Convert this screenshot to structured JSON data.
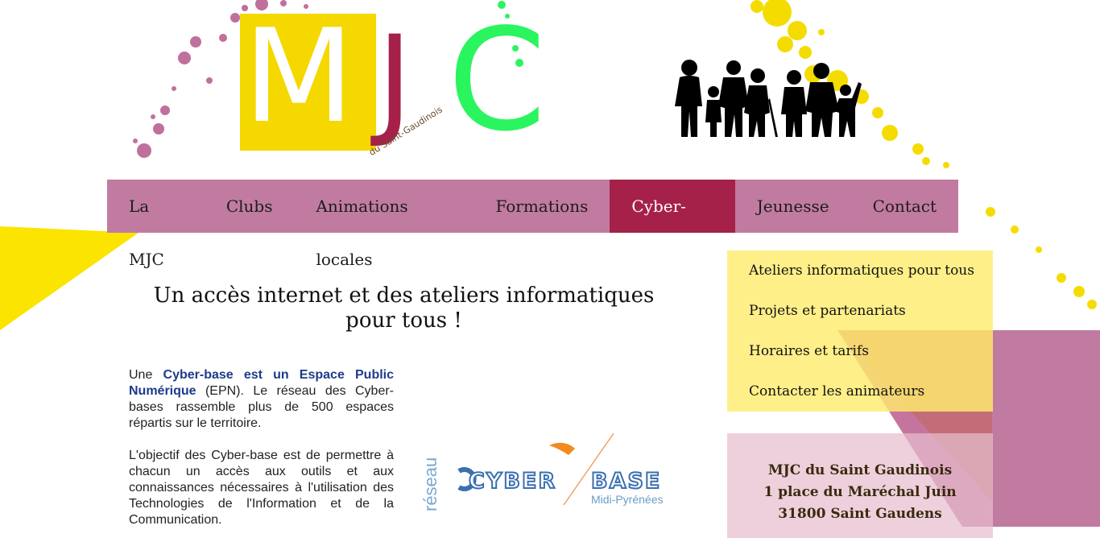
{
  "logo": {
    "letter_m": "M",
    "letter_j": "J",
    "letter_c": "C",
    "subtitle": "du Saint-Gaudinois"
  },
  "colors": {
    "nav_bg": "#c17ba0",
    "nav_active": "#a6214a",
    "yellow": "#f5d800",
    "green": "#2af55f",
    "link_blue": "#1d3b8a"
  },
  "nav": {
    "items": [
      {
        "label": "La MJC"
      },
      {
        "label": "Clubs"
      },
      {
        "label": "Animations locales"
      },
      {
        "label": "Formations"
      },
      {
        "label": "Cyber-base"
      },
      {
        "label": "Jeunesse"
      },
      {
        "label": "Contact"
      }
    ],
    "active": "Cyber-base"
  },
  "main": {
    "heading_line1": "Un accès internet et des ateliers informatiques",
    "heading_line2": "pour tous !",
    "p1_start": "Une ",
    "p1_bold": "Cyber-base est un Espace Public Numérique",
    "p1_rest": " (EPN). Le réseau des Cyber-bases rassemble plus de 500 espaces répartis sur le territoire.",
    "p2": "L'objectif des Cyber-base est de permettre à chacun un accès aux outils et aux connaissances nécessaires à l'utilisation des Technologies de l'Information et de la Communication."
  },
  "cyberbase_logo": {
    "vertical": "réseau",
    "word1": "CYBER",
    "word2": "BASE",
    "region": "Midi-Pyrénées"
  },
  "submenu": {
    "items": [
      {
        "label": "Ateliers informatiques pour tous"
      },
      {
        "label": "Projets et partenariats"
      },
      {
        "label": "Horaires et tarifs"
      },
      {
        "label": "Contacter les animateurs"
      }
    ]
  },
  "address": {
    "line1": "MJC du Saint Gaudinois",
    "line2": "1 place du Maréchal Juin",
    "line3": "31800 Saint Gaudens"
  }
}
